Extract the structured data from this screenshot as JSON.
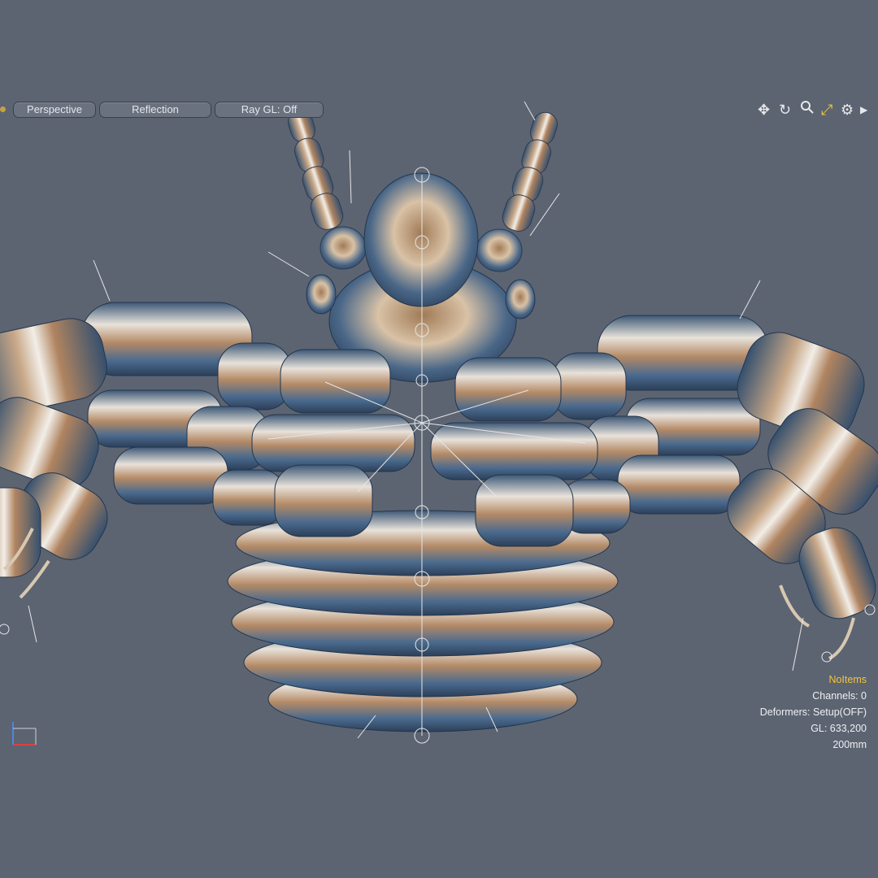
{
  "viewport": {
    "buttons": {
      "perspective": "Perspective",
      "reflection": "Reflection",
      "raygl": "Ray GL: Off"
    },
    "nav_icons": [
      "move-icon",
      "rotate-icon",
      "zoom-icon",
      "fit-icon",
      "gear-icon",
      "arrow-right-icon"
    ],
    "accent_color": "#f2c43c"
  },
  "info": {
    "items_label": "NoItems",
    "channels": "Channels: 0",
    "deformers": "Deformers: Setup(OFF)",
    "gl": "GL: 633,200",
    "scale": "200mm"
  }
}
